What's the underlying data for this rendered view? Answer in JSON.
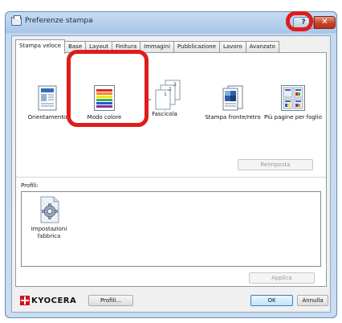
{
  "window": {
    "title": "Preferenze stampa",
    "help_label": "?",
    "close_label": "✕"
  },
  "tabs": [
    "Stampa veloce",
    "Base",
    "Layout",
    "Finitura",
    "Immagini",
    "Pubblicazione",
    "Lavoro",
    "Avanzato"
  ],
  "features": [
    {
      "label": "Orientamento",
      "icon": "orientation-icon"
    },
    {
      "label": "Modo colore",
      "icon": "color-mode-icon"
    },
    {
      "label": "Fascicola",
      "icon": "collate-icon"
    },
    {
      "label": "Stampa fronte/retro",
      "icon": "duplex-icon"
    },
    {
      "label": "Più pagine per foglio",
      "icon": "multiple-pages-icon"
    }
  ],
  "buttons": {
    "reset": "Reimposta",
    "apply": "Applica",
    "profiles": "Profili...",
    "ok": "OK",
    "cancel": "Annulla"
  },
  "profiles": {
    "label": "Profili:",
    "items": [
      {
        "label": "Impostazioni fabbrica",
        "icon": "factory-settings-icon"
      }
    ]
  },
  "brand": {
    "name": "KYOCERA",
    "color": "#d1111b"
  },
  "colors": {
    "highlight": "#e01b1b",
    "tab_border": "#919b9c"
  }
}
